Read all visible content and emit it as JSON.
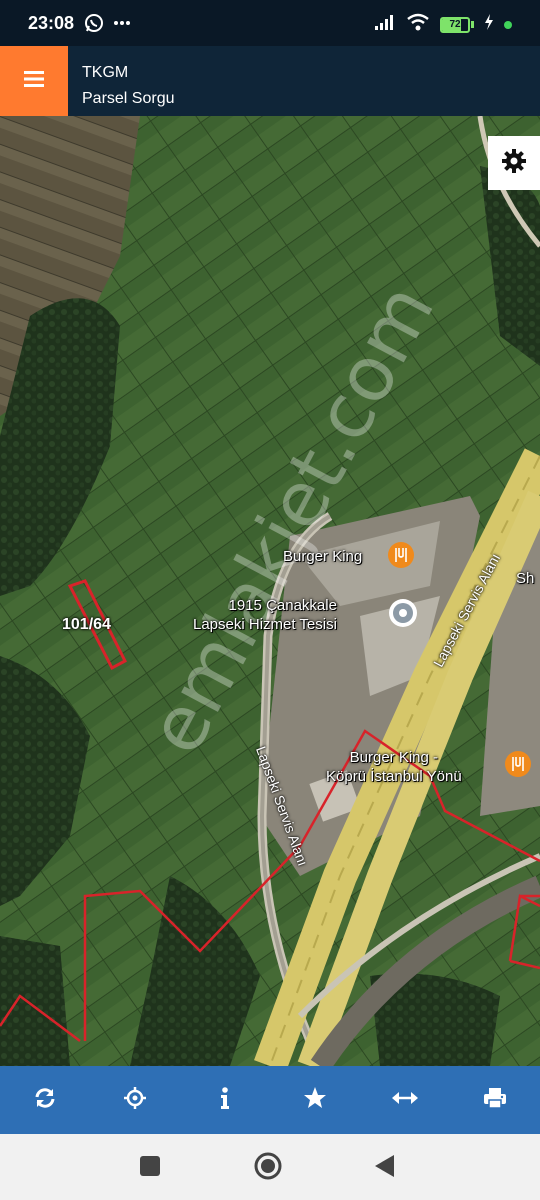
{
  "status": {
    "time": "23:08",
    "battery_level": 72,
    "battery_text": "72",
    "icons": [
      "whatsapp-icon",
      "more-icon",
      "signal-icon",
      "wifi-icon",
      "battery-icon",
      "charging-icon",
      "status-dot-icon"
    ],
    "colors": {
      "battery": "#7ee36a",
      "dot": "#40d35a"
    }
  },
  "header": {
    "title": "TKGM",
    "subtitle": "Parsel Sorgu",
    "menu_icon": "hamburger-menu-icon",
    "menu_color": "#ff7a2f"
  },
  "map": {
    "settings_icon": "gear-icon",
    "parcel_label": "101/64",
    "pois": [
      {
        "name": "Burger King",
        "icon": "restaurant-icon"
      },
      {
        "name": "1915 Çanakkale\nLapseki Hizmet Tesisi",
        "icon": "place-pin-icon"
      },
      {
        "name": "Burger King -\nKöprü İstanbul Yönü",
        "icon": "restaurant-icon"
      }
    ],
    "road_labels": [
      "Lapseki Servis Alanı",
      "Lapseki Servis Alanı"
    ],
    "partial_label": "Sh",
    "watermark": "emlakjet.com",
    "colors": {
      "parcel_outline": "#d8232a",
      "poi_marker": "#f08a1c"
    }
  },
  "toolbar": {
    "items": [
      {
        "name": "refresh-button",
        "icon": "refresh-icon"
      },
      {
        "name": "locate-button",
        "icon": "crosshair-icon"
      },
      {
        "name": "info-button",
        "icon": "info-icon"
      },
      {
        "name": "favorite-button",
        "icon": "star-icon"
      },
      {
        "name": "measure-button",
        "icon": "horizontal-arrows-icon"
      },
      {
        "name": "print-button",
        "icon": "print-icon"
      }
    ],
    "color": "#2e6fb5"
  },
  "navbar": {
    "icons": [
      "recents-square-icon",
      "home-circle-icon",
      "back-triangle-icon"
    ]
  }
}
